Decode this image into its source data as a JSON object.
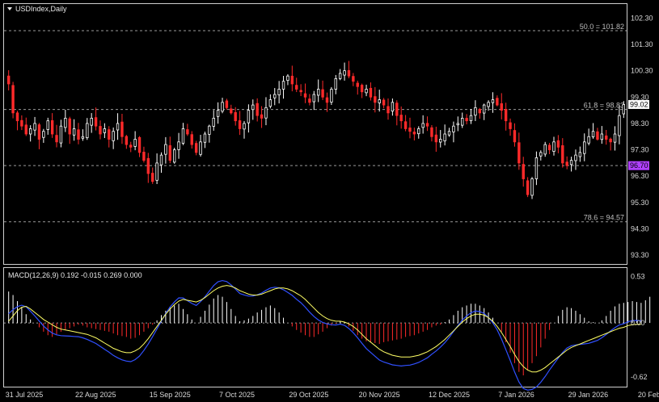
{
  "header": {
    "symbol_title": "USDIndex,Daily",
    "macd_title": "MACD(12,26,9) 0.192 -0.015 0.269 0.000"
  },
  "price_axis": {
    "ticks": [
      "102.30",
      "101.30",
      "100.30",
      "99.30",
      "98.30",
      "97.30",
      "96.30",
      "95.30",
      "94.30",
      "93.30"
    ],
    "tick_values": [
      102.3,
      101.3,
      100.3,
      99.3,
      98.3,
      97.3,
      96.3,
      95.3,
      94.3,
      93.3
    ],
    "current_price_label": "99.02",
    "current_price": 99.02,
    "highlight_label": "96.70",
    "highlight_value": 96.7,
    "ylim": [
      93.0,
      102.8
    ]
  },
  "macd_axis": {
    "ticks": [
      "0.53",
      "0.00",
      "-0.62"
    ],
    "tick_values": [
      0.53,
      0.0,
      -0.62
    ],
    "ylim": [
      -0.72,
      0.62
    ]
  },
  "fib_levels": [
    {
      "label": "50.0 = 101.82",
      "value": 101.82
    },
    {
      "label": "61.8 = 98.83",
      "value": 98.83
    },
    {
      "label": "78.6 = 94.57",
      "value": 94.57
    }
  ],
  "x_axis": {
    "ticks": [
      "31 Jul 2025",
      "22 Aug 2025",
      "15 Sep 2025",
      "7 Oct 2025",
      "29 Oct 2025",
      "20 Nov 2025",
      "12 Dec 2025",
      "7 Jan 2026",
      "29 Jan 2026",
      "20 Feb 2026"
    ],
    "tick_bar_index": [
      0,
      16,
      33,
      49,
      65,
      81,
      97,
      113,
      129,
      145
    ]
  },
  "colors": {
    "bull": "#ffffff",
    "bear": "#ff2a2a",
    "signal": "#ffff66",
    "macd_line": "#3050ff",
    "highlight_bg": "#b040ff",
    "border": "#cfcfcf",
    "grid": "#9a9a9a"
  },
  "chart_data": [
    {
      "type": "candlestick",
      "title": "USDIndex,Daily",
      "x_start": "31 Jul 2025",
      "close": [
        99.8,
        98.7,
        98.4,
        98.2,
        97.9,
        98.1,
        98.3,
        97.7,
        98.0,
        98.4,
        97.9,
        97.6,
        98.2,
        98.5,
        97.9,
        98.1,
        97.7,
        97.8,
        98.3,
        98.5,
        98.2,
        97.9,
        98.1,
        97.7,
        98.0,
        98.3,
        97.8,
        97.5,
        97.4,
        97.7,
        97.2,
        96.9,
        96.4,
        96.1,
        96.8,
        97.1,
        97.5,
        96.9,
        97.3,
        97.6,
        98.1,
        97.9,
        97.5,
        97.2,
        97.6,
        97.9,
        98.2,
        98.5,
        98.8,
        99.1,
        98.9,
        98.7,
        98.4,
        98.1,
        98.3,
        98.8,
        99.0,
        98.6,
        98.5,
        98.9,
        99.2,
        99.4,
        99.6,
        99.9,
        100.1,
        99.8,
        99.6,
        99.5,
        99.3,
        99.1,
        99.4,
        99.6,
        99.3,
        99.1,
        99.6,
        100.0,
        100.2,
        100.3,
        100.1,
        99.9,
        99.7,
        99.5,
        99.6,
        99.3,
        99.1,
        99.2,
        99.0,
        98.7,
        99.1,
        98.6,
        98.4,
        98.1,
        98.0,
        97.9,
        98.1,
        98.3,
        98.2,
        97.8,
        97.6,
        97.7,
        97.9,
        98.0,
        98.2,
        98.3,
        98.5,
        98.4,
        98.6,
        98.9,
        98.7,
        99.0,
        99.1,
        99.2,
        99.0,
        98.8,
        98.4,
        98.1,
        97.6,
        96.8,
        96.2,
        95.6,
        96.2,
        97.0,
        97.2,
        97.5,
        97.3,
        97.6,
        97.4,
        96.8,
        96.7,
        96.9,
        97.1,
        97.2,
        97.6,
        97.8,
        98.0,
        97.7,
        97.9,
        97.7,
        97.6,
        97.9,
        98.6,
        99.02
      ]
    },
    {
      "type": "macd",
      "title": "MACD(12,26,9) 0.192 -0.015 0.269 0.000",
      "main": 0.192,
      "signal": -0.015,
      "histogram": [
        0.36,
        0.32,
        0.25,
        0.18,
        0.1,
        0.04,
        0.0,
        -0.05,
        -0.1,
        -0.14,
        -0.16,
        -0.13,
        -0.1,
        -0.08,
        -0.06,
        -0.04,
        -0.02,
        -0.03,
        -0.05,
        -0.06,
        -0.07,
        -0.08,
        -0.09,
        -0.1,
        -0.12,
        -0.14,
        -0.15,
        -0.16,
        -0.18,
        -0.17,
        -0.14,
        -0.1,
        -0.06,
        -0.02,
        0.03,
        0.09,
        0.14,
        0.18,
        0.2,
        0.22,
        0.16,
        0.1,
        0.04,
        0.0,
        0.07,
        0.14,
        0.21,
        0.28,
        0.32,
        0.3,
        0.24,
        0.16,
        0.08,
        0.02,
        0.03,
        0.05,
        0.08,
        0.12,
        0.15,
        0.18,
        0.2,
        0.17,
        0.12,
        0.06,
        0.0,
        -0.04,
        -0.08,
        -0.11,
        -0.14,
        -0.16,
        -0.16,
        -0.13,
        -0.1,
        -0.06,
        -0.03,
        -0.01,
        0.02,
        0.01,
        -0.04,
        -0.09,
        -0.14,
        -0.18,
        -0.21,
        -0.22,
        -0.23,
        -0.24,
        -0.22,
        -0.21,
        -0.2,
        -0.19,
        -0.18,
        -0.16,
        -0.15,
        -0.14,
        -0.12,
        -0.1,
        -0.08,
        -0.05,
        -0.03,
        -0.02,
        0.01,
        0.04,
        0.09,
        0.14,
        0.18,
        0.2,
        0.22,
        0.22,
        0.2,
        0.17,
        0.12,
        0.06,
        0.0,
        -0.1,
        -0.22,
        -0.34,
        -0.46,
        -0.56,
        -0.6,
        -0.54,
        -0.46,
        -0.38,
        -0.28,
        -0.18,
        -0.08,
        0.0,
        0.08,
        0.15,
        0.18,
        0.17,
        0.14,
        0.1,
        0.06,
        0.02,
        0.01,
        0.0,
        0.03,
        0.08,
        0.14,
        0.19,
        0.22,
        0.23,
        0.24,
        0.25,
        0.24,
        0.23,
        0.26,
        0.3
      ],
      "signal_line": [
        0.02,
        0.08,
        0.14,
        0.18,
        0.19,
        0.16,
        0.12,
        0.08,
        0.04,
        0.01,
        -0.02,
        -0.05,
        -0.07,
        -0.08,
        -0.09,
        -0.1,
        -0.11,
        -0.12,
        -0.13,
        -0.15,
        -0.17,
        -0.2,
        -0.23,
        -0.26,
        -0.29,
        -0.31,
        -0.33,
        -0.34,
        -0.34,
        -0.32,
        -0.29,
        -0.24,
        -0.18,
        -0.11,
        -0.04,
        0.03,
        0.1,
        0.16,
        0.21,
        0.25,
        0.27,
        0.26,
        0.25,
        0.24,
        0.26,
        0.29,
        0.33,
        0.37,
        0.4,
        0.42,
        0.43,
        0.42,
        0.4,
        0.37,
        0.35,
        0.33,
        0.32,
        0.32,
        0.33,
        0.35,
        0.37,
        0.39,
        0.4,
        0.4,
        0.39,
        0.37,
        0.34,
        0.31,
        0.27,
        0.22,
        0.17,
        0.12,
        0.08,
        0.05,
        0.03,
        0.02,
        0.02,
        0.01,
        -0.01,
        -0.04,
        -0.08,
        -0.13,
        -0.18,
        -0.22,
        -0.26,
        -0.3,
        -0.33,
        -0.35,
        -0.37,
        -0.38,
        -0.39,
        -0.39,
        -0.39,
        -0.38,
        -0.37,
        -0.35,
        -0.33,
        -0.3,
        -0.27,
        -0.23,
        -0.19,
        -0.14,
        -0.09,
        -0.04,
        0.01,
        0.05,
        0.08,
        0.1,
        0.1,
        0.09,
        0.06,
        0.02,
        -0.04,
        -0.11,
        -0.19,
        -0.27,
        -0.36,
        -0.44,
        -0.5,
        -0.54,
        -0.56,
        -0.56,
        -0.54,
        -0.51,
        -0.47,
        -0.43,
        -0.39,
        -0.35,
        -0.31,
        -0.28,
        -0.26,
        -0.24,
        -0.22,
        -0.2,
        -0.18,
        -0.16,
        -0.14,
        -0.12,
        -0.1,
        -0.08,
        -0.06,
        -0.05,
        -0.03,
        -0.02,
        -0.015,
        -0.015
      ],
      "ylim": [
        -0.72,
        0.62
      ]
    }
  ]
}
